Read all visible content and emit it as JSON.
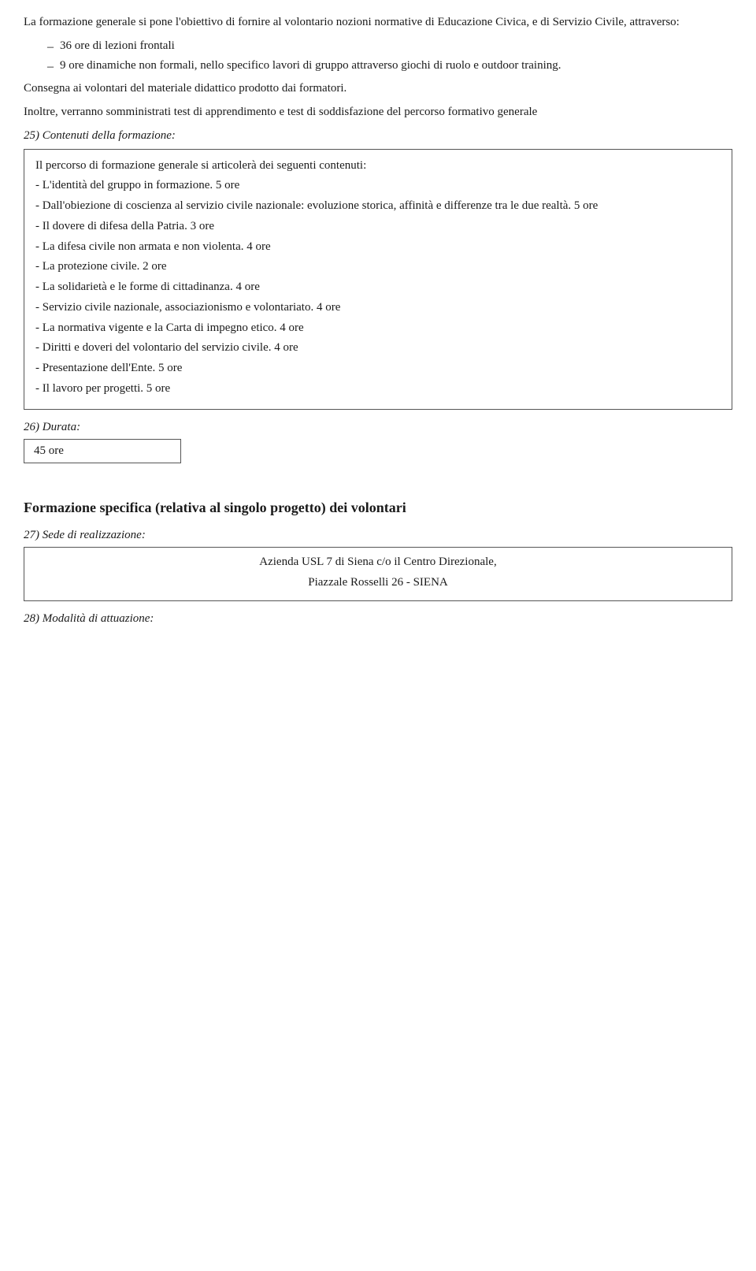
{
  "intro": {
    "paragraph1": "La formazione generale si pone l'obiettivo di fornire al volontario nozioni normative di Educazione Civica, e di Servizio Civile, attraverso:",
    "list": [
      "36 ore di lezioni frontali",
      "9 ore dinamiche non formali, nello specifico lavori di gruppo attraverso giochi di ruolo e outdoor training."
    ],
    "paragraph2": "Consegna ai volontari del materiale didattico prodotto dai formatori.",
    "paragraph3": "Inoltre, verranno somministrati test di apprendimento e test di soddisfazione del percorso formativo generale"
  },
  "section25": {
    "heading": "25) Contenuti della formazione:",
    "box_content": {
      "line1": "Il percorso di formazione generale si articolerà dei seguenti contenuti:",
      "items": [
        "- L'identità del gruppo in formazione. 5 ore",
        "- Dall'obiezione di coscienza al servizio civile nazionale: evoluzione storica, affinità e differenze tra le due realtà. 5 ore",
        "- Il dovere di difesa della Patria. 3 ore",
        "- La difesa civile non armata e non violenta. 4 ore",
        "- La protezione civile. 2 ore",
        "- La solidarietà e le forme di cittadinanza. 4 ore",
        "-   Servizio civile nazionale, associazionismo e volontariato. 4 ore",
        "- La normativa vigente e la Carta di impegno etico. 4 ore",
        "- Diritti e doveri del volontario del servizio civile. 4 ore",
        "- Presentazione dell'Ente. 5 ore",
        "- Il lavoro per progetti. 5 ore"
      ]
    }
  },
  "section26": {
    "heading": "26) Durata:",
    "value": "45 ore"
  },
  "big_heading": "Formazione specifica (relativa al singolo progetto) dei volontari",
  "section27": {
    "heading": "27) Sede di realizzazione:",
    "box_line1": "Azienda USL 7 di Siena c/o il Centro Direzionale,",
    "box_line2": "Piazzale Rosselli 26 - SIENA"
  },
  "section28": {
    "heading": "28) Modalità di attuazione:"
  }
}
